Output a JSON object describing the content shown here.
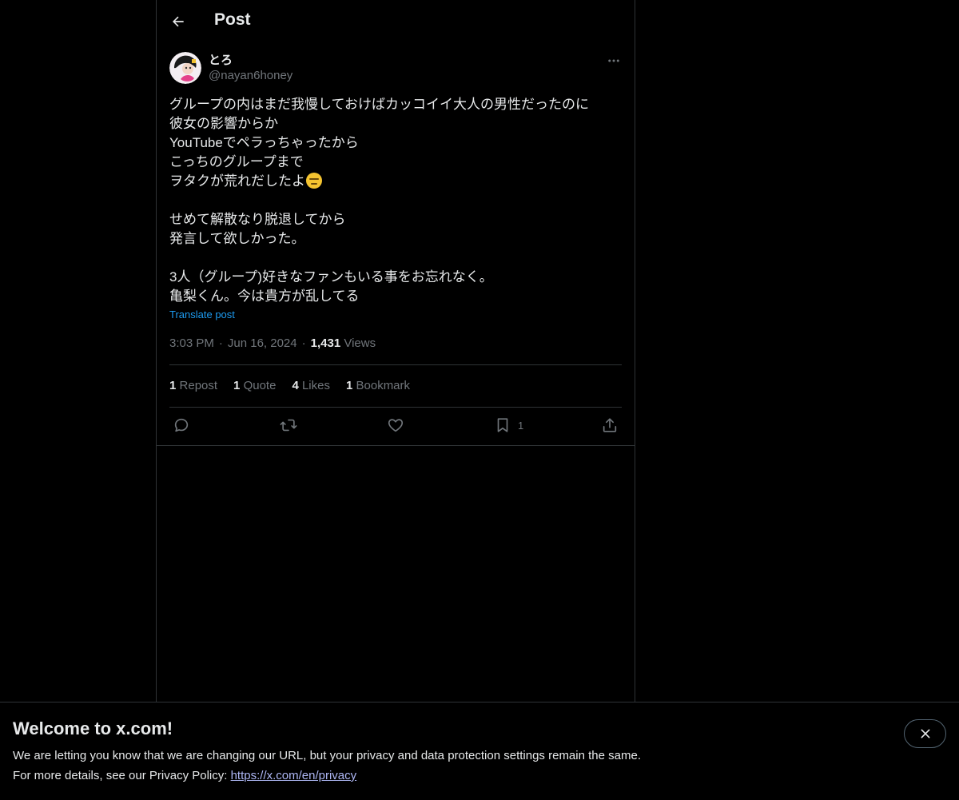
{
  "header": {
    "title": "Post"
  },
  "author": {
    "display_name": "とろ",
    "handle": "@nayan6honey"
  },
  "post": {
    "lines": [
      "グループの内はまだ我慢しておけばカッコイイ大人の男性だったのに",
      "彼女の影響からか",
      "YouTubeでペラっちゃったから",
      "こっちのグループまで",
      "ヲタクが荒れだしたよ",
      "",
      "せめて解散なり脱退してから",
      "発言して欲しかった。",
      "",
      "3人（グループ)好きなファンもいる事をお忘れなく。",
      "亀梨くん。今は貴方が乱してる"
    ],
    "translate_label": "Translate post",
    "time": "3:03 PM",
    "date": "Jun 16, 2024",
    "views_count": "1,431",
    "views_label": "Views"
  },
  "stats": {
    "reposts": {
      "count": "1",
      "label": "Repost"
    },
    "quotes": {
      "count": "1",
      "label": "Quote"
    },
    "likes": {
      "count": "4",
      "label": "Likes"
    },
    "bookmarks": {
      "count": "1",
      "label": "Bookmark"
    }
  },
  "actions": {
    "bookmark_count": "1"
  },
  "banner": {
    "title": "Welcome to x.com!",
    "line1": "We are letting you know that we are changing our URL, but your privacy and data protection settings remain the same.",
    "line2_prefix": "For more details, see our Privacy Policy: ",
    "link": "https://x.com/en/privacy"
  },
  "colors": {
    "background": "#000000",
    "text": "#e7e9ea",
    "secondary": "#71767b",
    "border": "#2f3336",
    "link": "#1d9bf0"
  },
  "icons": [
    "back-arrow-icon",
    "more-icon",
    "reply-icon",
    "repost-icon",
    "like-icon",
    "bookmark-icon",
    "share-icon",
    "close-icon",
    "emoji-expressionless-icon"
  ]
}
